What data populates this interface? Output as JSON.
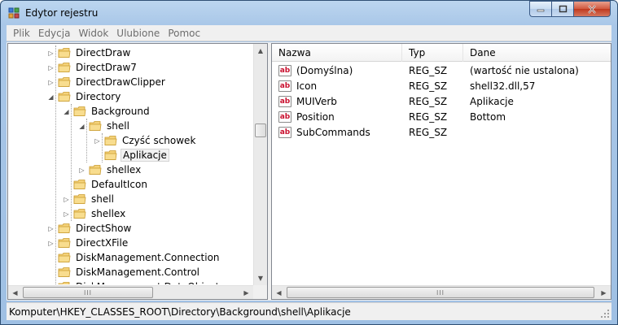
{
  "window": {
    "title": "Edytor rejestru"
  },
  "menu": [
    "Plik",
    "Edycja",
    "Widok",
    "Ulubione",
    "Pomoc"
  ],
  "tree": [
    {
      "label": "DirectDraw",
      "level": 0,
      "expander": "collapsed"
    },
    {
      "label": "DirectDraw7",
      "level": 0,
      "expander": "collapsed"
    },
    {
      "label": "DirectDrawClipper",
      "level": 0,
      "expander": "collapsed"
    },
    {
      "label": "Directory",
      "level": 0,
      "expander": "expanded"
    },
    {
      "label": "Background",
      "level": 1,
      "expander": "expanded"
    },
    {
      "label": "shell",
      "level": 2,
      "expander": "expanded"
    },
    {
      "label": "Czyść schowek",
      "level": 3,
      "expander": "collapsed"
    },
    {
      "label": "Aplikacje",
      "level": 3,
      "expander": "none",
      "selected": true
    },
    {
      "label": "shellex",
      "level": 2,
      "expander": "collapsed"
    },
    {
      "label": "DefaultIcon",
      "level": 1,
      "expander": "none"
    },
    {
      "label": "shell",
      "level": 1,
      "expander": "collapsed"
    },
    {
      "label": "shellex",
      "level": 1,
      "expander": "collapsed"
    },
    {
      "label": "DirectShow",
      "level": 0,
      "expander": "collapsed"
    },
    {
      "label": "DirectXFile",
      "level": 0,
      "expander": "collapsed"
    },
    {
      "label": "DiskManagement.Connection",
      "level": 0,
      "expander": "none"
    },
    {
      "label": "DiskManagement.Control",
      "level": 0,
      "expander": "none"
    },
    {
      "label": "DiskManagement.DataObject",
      "level": 0,
      "expander": "none"
    }
  ],
  "list": {
    "columns": [
      "Nazwa",
      "Typ",
      "Dane"
    ],
    "rows": [
      {
        "name": "(Domyślna)",
        "type": "REG_SZ",
        "data": "(wartość nie ustalona)"
      },
      {
        "name": "Icon",
        "type": "REG_SZ",
        "data": "shell32.dll,57"
      },
      {
        "name": "MUIVerb",
        "type": "REG_SZ",
        "data": "Aplikacje"
      },
      {
        "name": "Position",
        "type": "REG_SZ",
        "data": "Bottom"
      },
      {
        "name": "SubCommands",
        "type": "REG_SZ",
        "data": ""
      }
    ],
    "value_icon_text": "ab"
  },
  "status": {
    "path": "Komputer\\HKEY_CLASSES_ROOT\\Directory\\Background\\shell\\Aplikacje"
  },
  "scroll_glyph": "III",
  "icons": {
    "folder": "folder-icon",
    "value": "string-value-icon",
    "app": "registry-editor-icon"
  }
}
